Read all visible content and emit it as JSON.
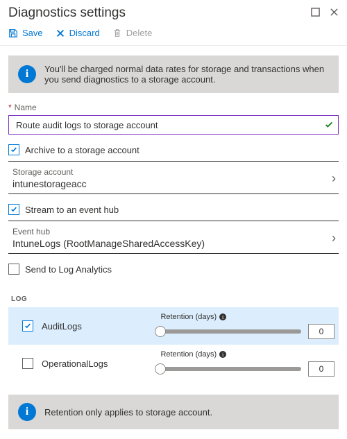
{
  "title": "Diagnostics settings",
  "toolbar": {
    "save": "Save",
    "discard": "Discard",
    "delete": "Delete"
  },
  "banners": {
    "storage_charge": "You'll be charged normal data rates for storage and transactions when you send diagnostics to a storage account.",
    "retention_note": "Retention only applies to storage account."
  },
  "name": {
    "label": "Name",
    "value": "Route audit logs to storage account"
  },
  "options": {
    "archive_storage": "Archive to a storage account",
    "stream_eventhub": "Stream to an event hub",
    "send_loganalytics": "Send to Log Analytics"
  },
  "storage": {
    "label": "Storage account",
    "value": "intunestorageacc"
  },
  "eventhub": {
    "label": "Event hub",
    "value": "IntuneLogs (RootManageSharedAccessKey)"
  },
  "log_section": {
    "heading": "LOG",
    "retention_label": "Retention (days)",
    "items": [
      {
        "name": "AuditLogs",
        "retention": "0"
      },
      {
        "name": "OperationalLogs",
        "retention": "0"
      }
    ]
  }
}
